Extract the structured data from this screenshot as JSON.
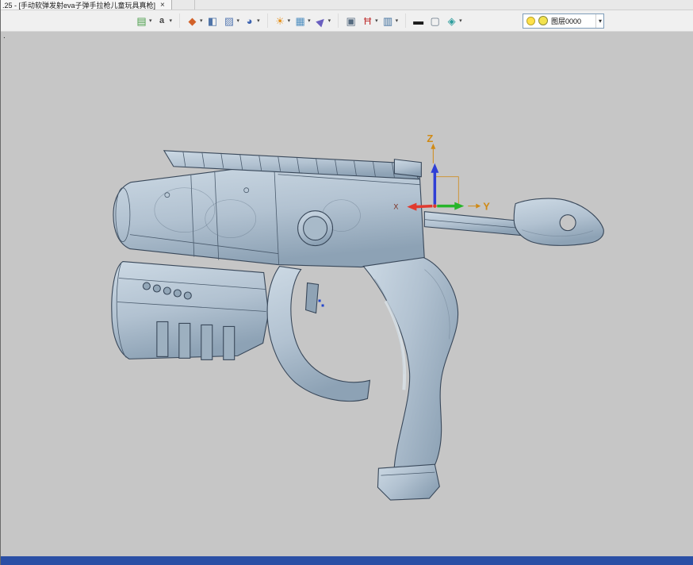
{
  "tabbar": {
    "tab_title": ".25 - [手动软弹发射eva子弹手拉枪儿童玩具真枪]",
    "close_glyph": "×"
  },
  "toolbar": {
    "caret_glyph": "▾",
    "icons": [
      {
        "name": "paste",
        "glyph": "▤",
        "style": "color:#4a9e4a"
      },
      {
        "name": "text-style",
        "glyph": "a",
        "style": "color:#444444;font-weight:bold;font-size:11px"
      },
      {
        "name": "sketch",
        "glyph": "◆",
        "style": "color:#d2622a"
      },
      {
        "name": "extrude",
        "glyph": "◧",
        "style": "color:#4f74a8"
      },
      {
        "name": "solid",
        "glyph": "▨",
        "style": "color:#5d7fb5"
      },
      {
        "name": "sphere",
        "glyph": "◕",
        "style": "color:#3c63b0"
      },
      {
        "name": "color-wheel",
        "glyph": "☀",
        "style": "color:#e6921e"
      },
      {
        "name": "texture",
        "glyph": "▦",
        "style": "color:#4f8fc0"
      },
      {
        "name": "compass",
        "glyph": "▶",
        "style": "color:#6a5fc0;transform:rotate(-45deg)"
      },
      {
        "name": "window",
        "glyph": "▣",
        "style": "color:#566b80"
      },
      {
        "name": "dimension",
        "glyph": "Ħ",
        "style": "color:#c23a3a"
      },
      {
        "name": "display",
        "glyph": "▥",
        "style": "color:#3f6f9e"
      },
      {
        "name": "line-width",
        "glyph": "▬",
        "style": "color:#1b1b1b"
      },
      {
        "name": "frame",
        "glyph": "▢",
        "style": "color:#6b7b8a"
      },
      {
        "name": "visibility",
        "glyph": "◈",
        "style": "color:#2d9d9d"
      }
    ],
    "layer": {
      "value": "图层0000",
      "bulb_style": "background:#ffe14a",
      "swatch_style": "background:#f2e24e",
      "caret_glyph": "▾"
    }
  },
  "viewport": {
    "corner_dot": ".",
    "canvas_style": "background:#c6c6c6",
    "axes": {
      "x_label": "X",
      "y_label": "Y",
      "z_label": "Z",
      "x_color": "#e03a2f",
      "y_color": "#27b52a",
      "z_color": "#2f3fd6",
      "label_color": "#d08a16"
    },
    "colors": {
      "canvas_bg": "#c6c6c6",
      "body_light": "#ccd9e4",
      "body_mid": "#b2c2d1",
      "body_dark": "#8da2b5",
      "outline": "#39485a"
    }
  },
  "statusbar": {
    "style": "background:#2a4fa5"
  }
}
